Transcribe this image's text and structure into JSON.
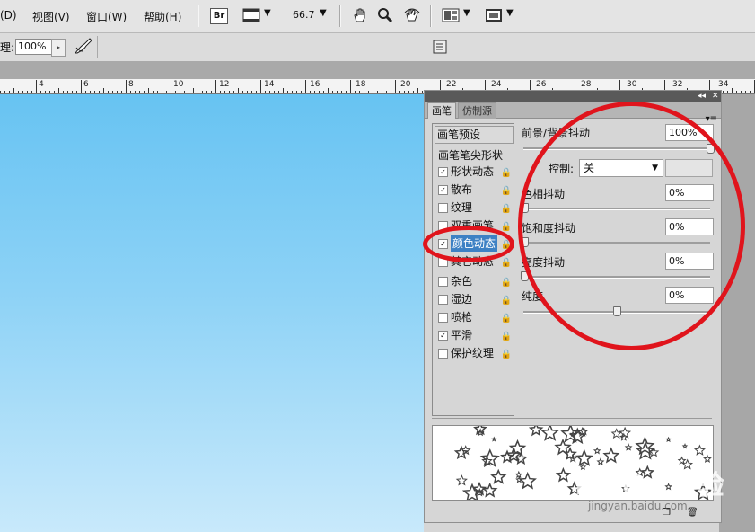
{
  "menubar": {
    "items": [
      "(D)",
      "视图(V)",
      "窗口(W)",
      "帮助(H)"
    ],
    "bridge_label": "Br",
    "zoom": "66.7"
  },
  "options": {
    "flow_label": "理:",
    "flow_value": "100%"
  },
  "ruler": {
    "labels": [
      "4",
      "6",
      "8",
      "10",
      "12",
      "14",
      "16",
      "18",
      "20",
      "22",
      "24",
      "26",
      "28",
      "30",
      "32",
      "34"
    ]
  },
  "panel": {
    "tabs": [
      "画笔",
      "仿制源"
    ],
    "presets_button": "画笔预设",
    "tip_shape": "画笔笔尖形状",
    "items": [
      {
        "label": "形状动态",
        "checked": "✓",
        "lock": "🔒"
      },
      {
        "label": "散布",
        "checked": "✓",
        "lock": "🔒"
      },
      {
        "label": "纹理",
        "checked": "",
        "lock": "🔒"
      },
      {
        "label": "双重画笔",
        "checked": "",
        "lock": "🔒"
      },
      {
        "label": "颜色动态",
        "checked": "✓",
        "lock": "🔒"
      },
      {
        "label": "其它动态",
        "checked": "",
        "lock": "🔒"
      },
      {
        "label": "杂色",
        "checked": "",
        "lock": "🔒"
      },
      {
        "label": "湿边",
        "checked": "",
        "lock": "🔒"
      },
      {
        "label": "喷枪",
        "checked": "",
        "lock": "🔒"
      },
      {
        "label": "平滑",
        "checked": "✓",
        "lock": "🔒"
      },
      {
        "label": "保护纹理",
        "checked": "",
        "lock": "🔒"
      }
    ],
    "settings": {
      "fg_bg_jitter": {
        "label": "前景/背景抖动",
        "value": "100%"
      },
      "control": {
        "label": "控制:",
        "value": "关"
      },
      "hue_jitter": {
        "label": "色相抖动",
        "value": "0%"
      },
      "saturation_jitter": {
        "label": "饱和度抖动",
        "value": "0%"
      },
      "brightness_jitter": {
        "label": "亮度抖动",
        "value": "0%"
      },
      "purity": {
        "label": "纯度",
        "value": "0%"
      }
    }
  },
  "watermark": {
    "text": "Baidu 经验",
    "url": "jingyan.baidu.com"
  },
  "colors": {
    "annotation": "#e0141c",
    "selection": "#3d81c4",
    "canvas_top": "#67c3f2",
    "canvas_bottom": "#c8e9fb"
  }
}
